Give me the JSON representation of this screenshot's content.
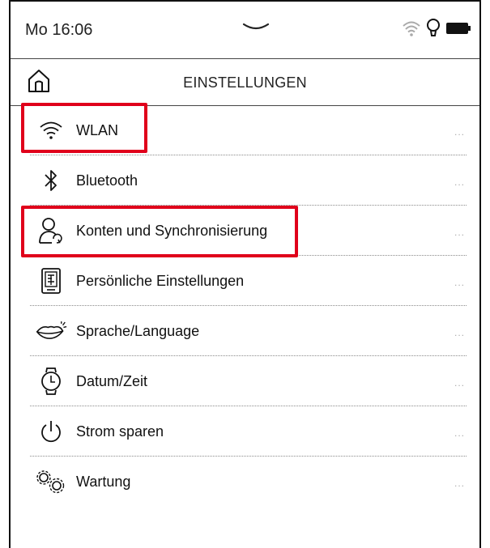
{
  "status_bar": {
    "time": "Mo 16:06",
    "icons": [
      "chevron-down-icon",
      "wifi-icon",
      "light-bulb-icon",
      "battery-icon"
    ]
  },
  "header": {
    "title": "EINSTELLUNGEN",
    "home_icon": "home-icon"
  },
  "settings": {
    "items": [
      {
        "label": "WLAN",
        "icon": "wifi-icon",
        "more": "...",
        "highlighted": true
      },
      {
        "label": "Bluetooth",
        "icon": "bluetooth-icon",
        "more": "...",
        "highlighted": false
      },
      {
        "label": "Konten und Synchronisierung",
        "icon": "account-sync-icon",
        "more": "...",
        "highlighted": true
      },
      {
        "label": "Persönliche Einstellungen",
        "icon": "personal-settings-icon",
        "more": "...",
        "highlighted": false
      },
      {
        "label": "Sprache/Language",
        "icon": "language-icon",
        "more": "...",
        "highlighted": false
      },
      {
        "label": "Datum/Zeit",
        "icon": "watch-icon",
        "more": "...",
        "highlighted": false
      },
      {
        "label": "Strom sparen",
        "icon": "power-icon",
        "more": "...",
        "highlighted": false
      },
      {
        "label": "Wartung",
        "icon": "gears-icon",
        "more": "...",
        "highlighted": false
      }
    ]
  },
  "colors": {
    "highlight": "#e0001b",
    "text": "#111111",
    "background": "#ffffff"
  }
}
